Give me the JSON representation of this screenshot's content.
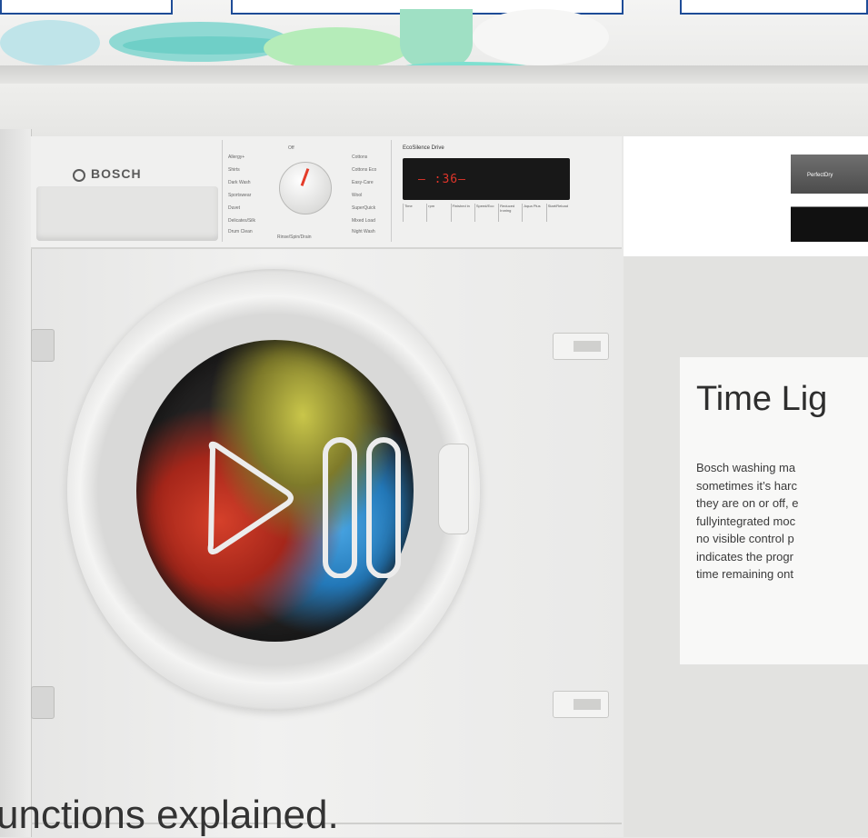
{
  "washer": {
    "brand": "BOSCH",
    "display_title": "EcoSilence Drive",
    "display_readout": "– :36–",
    "program_labels_left": [
      "Allergy+",
      "Shirts",
      "Dark Wash",
      "Sportswear",
      "Duvet",
      "Delicates/Silk",
      "Drum Clean"
    ],
    "program_labels_right": [
      "Cottons",
      "Cottons Eco",
      "Easy-Care",
      "Wool",
      "SuperQuick",
      "Mixed Load",
      "Night Wash"
    ],
    "program_labels_bottom": "Rinse/Spin/Drain",
    "program_label_top": "Off",
    "buttons": [
      "Time",
      "rpm",
      "Finished in",
      "Speed/Eco",
      "Reduced Ironing",
      "Aqua Plus",
      "Start/Reload"
    ]
  },
  "dryer": {
    "panel_label": "PerfectDry"
  },
  "card": {
    "title": "Time Lig",
    "body_lines": [
      "Bosch washing ma",
      "sometimes it’s harc",
      "they are on or off, e",
      "fullyintegrated moc",
      "no visible control p",
      "indicates the progr",
      "time remaining ont"
    ]
  },
  "headline": "unctions explained.",
  "colors": {
    "accent_border": "#1e4c97",
    "display_red": "#e0352a"
  },
  "icons": [
    "play-pause-icon",
    "bosch-logo-icon"
  ]
}
